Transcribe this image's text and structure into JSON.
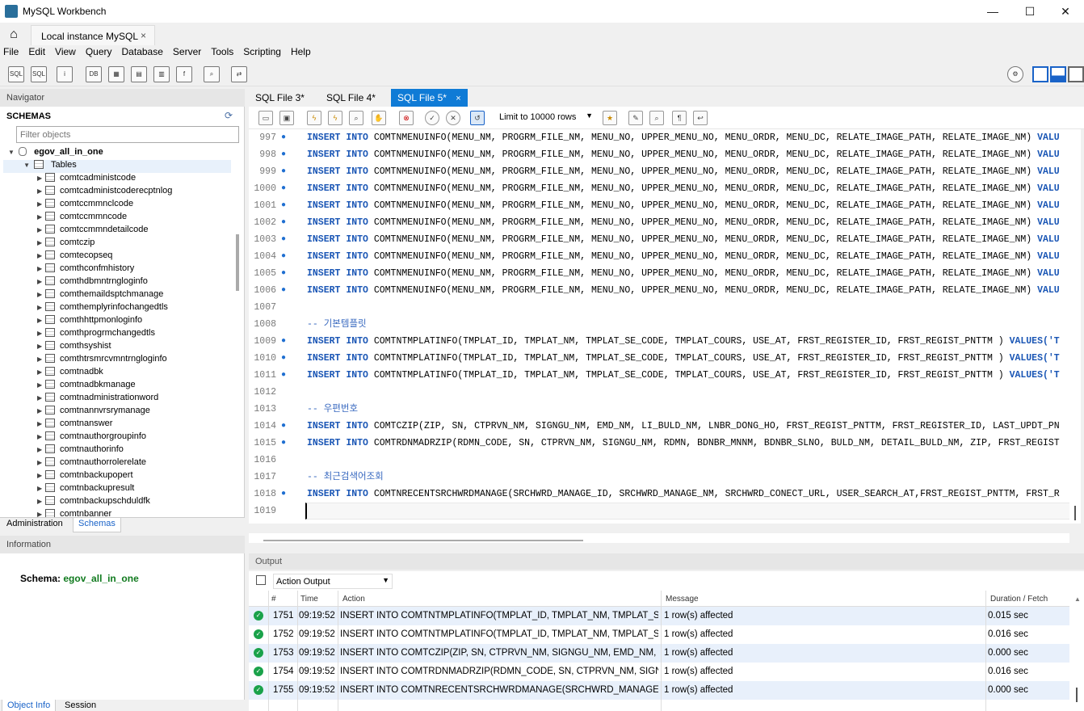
{
  "window": {
    "title": "MySQL Workbench",
    "minimize": "—",
    "maximize": "☐",
    "close": "✕"
  },
  "connection_tab": {
    "label": "Local instance MySQL",
    "close": "×",
    "home_icon": "⌂"
  },
  "menu": [
    "File",
    "Edit",
    "View",
    "Query",
    "Database",
    "Server",
    "Tools",
    "Scripting",
    "Help"
  ],
  "toolbar_icons": [
    "new-sql-tab-icon",
    "open-sql-script-icon",
    "inspector-icon",
    "create-schema-icon",
    "create-table-icon",
    "create-view-icon",
    "create-procedure-icon",
    "create-function-icon",
    "search-table-icon",
    "reconnect-icon"
  ],
  "navigator": {
    "header": "Navigator",
    "schemas_title": "SCHEMAS",
    "filter_placeholder": "Filter objects",
    "schema_name": "egov_all_in_one",
    "tables_label": "Tables",
    "tables": [
      "comtcadministcode",
      "comtcadministcoderecptnlog",
      "comtccmmnclcode",
      "comtccmmncode",
      "comtccmmndetailcode",
      "comtczip",
      "comtecopseq",
      "comthconfmhistory",
      "comthdbmntrngloginfo",
      "comthemaildsptchmanage",
      "comthemplyrinfochangedtls",
      "comthhttpmonloginfo",
      "comthprogrmchangedtls",
      "comthsyshist",
      "comthtrsmrcvmntrngloginfo",
      "comtnadbk",
      "comtnadbkmanage",
      "comtnadministrationword",
      "comtnannvrsrymanage",
      "comtnanswer",
      "comtnauthorgroupinfo",
      "comtnauthorinfo",
      "comtnauthorrolerelate",
      "comtnbackupopert",
      "comtnbackupresult",
      "comtnbackupschduldfk",
      "comtnbanner"
    ],
    "tabs": [
      "Administration",
      "Schemas"
    ]
  },
  "information": {
    "header": "Information",
    "schema_label": "Schema:",
    "schema_value": "egov_all_in_one",
    "tabs": [
      "Object Info",
      "Session"
    ]
  },
  "editor": {
    "tabs": [
      "SQL File 3*",
      "SQL File 4*",
      "SQL File 5*"
    ],
    "active_tab_close": "×",
    "limit_label": "Limit to 10000 rows",
    "lines": [
      {
        "n": "997",
        "dot": true,
        "kw1": "INSERT",
        "kw2": "INTO",
        "text": "COMTNMENUINFO(MENU_NM, PROGRM_FILE_NM, MENU_NO, UPPER_MENU_NO, MENU_ORDR, MENU_DC, RELATE_IMAGE_PATH, RELATE_IMAGE_NM)",
        "tail": "VALU"
      },
      {
        "n": "998",
        "dot": true,
        "kw1": "INSERT",
        "kw2": "INTO",
        "text": "COMTNMENUINFO(MENU_NM, PROGRM_FILE_NM, MENU_NO, UPPER_MENU_NO, MENU_ORDR, MENU_DC, RELATE_IMAGE_PATH, RELATE_IMAGE_NM)",
        "tail": "VALU"
      },
      {
        "n": "999",
        "dot": true,
        "kw1": "INSERT",
        "kw2": "INTO",
        "text": "COMTNMENUINFO(MENU_NM, PROGRM_FILE_NM, MENU_NO, UPPER_MENU_NO, MENU_ORDR, MENU_DC, RELATE_IMAGE_PATH, RELATE_IMAGE_NM)",
        "tail": "VALU"
      },
      {
        "n": "1000",
        "dot": true,
        "kw1": "INSERT",
        "kw2": "INTO",
        "text": "COMTNMENUINFO(MENU_NM, PROGRM_FILE_NM, MENU_NO, UPPER_MENU_NO, MENU_ORDR, MENU_DC, RELATE_IMAGE_PATH, RELATE_IMAGE_NM)",
        "tail": "VALU"
      },
      {
        "n": "1001",
        "dot": true,
        "kw1": "INSERT",
        "kw2": "INTO",
        "text": "COMTNMENUINFO(MENU_NM, PROGRM_FILE_NM, MENU_NO, UPPER_MENU_NO, MENU_ORDR, MENU_DC, RELATE_IMAGE_PATH, RELATE_IMAGE_NM)",
        "tail": "VALU"
      },
      {
        "n": "1002",
        "dot": true,
        "kw1": "INSERT",
        "kw2": "INTO",
        "text": "COMTNMENUINFO(MENU_NM, PROGRM_FILE_NM, MENU_NO, UPPER_MENU_NO, MENU_ORDR, MENU_DC, RELATE_IMAGE_PATH, RELATE_IMAGE_NM)",
        "tail": "VALU"
      },
      {
        "n": "1003",
        "dot": true,
        "kw1": "INSERT",
        "kw2": "INTO",
        "text": "COMTNMENUINFO(MENU_NM, PROGRM_FILE_NM, MENU_NO, UPPER_MENU_NO, MENU_ORDR, MENU_DC, RELATE_IMAGE_PATH, RELATE_IMAGE_NM)",
        "tail": "VALU"
      },
      {
        "n": "1004",
        "dot": true,
        "kw1": "INSERT",
        "kw2": "INTO",
        "text": "COMTNMENUINFO(MENU_NM, PROGRM_FILE_NM, MENU_NO, UPPER_MENU_NO, MENU_ORDR, MENU_DC, RELATE_IMAGE_PATH, RELATE_IMAGE_NM)",
        "tail": "VALU"
      },
      {
        "n": "1005",
        "dot": true,
        "kw1": "INSERT",
        "kw2": "INTO",
        "text": "COMTNMENUINFO(MENU_NM, PROGRM_FILE_NM, MENU_NO, UPPER_MENU_NO, MENU_ORDR, MENU_DC, RELATE_IMAGE_PATH, RELATE_IMAGE_NM)",
        "tail": "VALU"
      },
      {
        "n": "1006",
        "dot": true,
        "kw1": "INSERT",
        "kw2": "INTO",
        "text": "COMTNMENUINFO(MENU_NM, PROGRM_FILE_NM, MENU_NO, UPPER_MENU_NO, MENU_ORDR, MENU_DC, RELATE_IMAGE_PATH, RELATE_IMAGE_NM)",
        "tail": "VALU"
      },
      {
        "n": "1007",
        "dot": false,
        "kw1": "",
        "kw2": "",
        "text": "",
        "tail": ""
      },
      {
        "n": "1008",
        "dot": false,
        "kw1": "",
        "kw2": "",
        "comment": "-- 기본템플릿",
        "text": "",
        "tail": ""
      },
      {
        "n": "1009",
        "dot": true,
        "kw1": "INSERT",
        "kw2": "INTO",
        "text": "COMTNTMPLATINFO(TMPLAT_ID, TMPLAT_NM, TMPLAT_SE_CODE, TMPLAT_COURS, USE_AT, FRST_REGISTER_ID, FRST_REGIST_PNTTM )",
        "tail": "VALUES('T"
      },
      {
        "n": "1010",
        "dot": true,
        "kw1": "INSERT",
        "kw2": "INTO",
        "text": "COMTNTMPLATINFO(TMPLAT_ID, TMPLAT_NM, TMPLAT_SE_CODE, TMPLAT_COURS, USE_AT, FRST_REGISTER_ID, FRST_REGIST_PNTTM )",
        "tail": "VALUES('T"
      },
      {
        "n": "1011",
        "dot": true,
        "kw1": "INSERT",
        "kw2": "INTO",
        "text": "COMTNTMPLATINFO(TMPLAT_ID, TMPLAT_NM, TMPLAT_SE_CODE, TMPLAT_COURS, USE_AT, FRST_REGISTER_ID, FRST_REGIST_PNTTM )",
        "tail": "VALUES('T"
      },
      {
        "n": "1012",
        "dot": false,
        "kw1": "",
        "kw2": "",
        "text": "",
        "tail": ""
      },
      {
        "n": "1013",
        "dot": false,
        "kw1": "",
        "kw2": "",
        "comment": "-- 우편번호",
        "text": "",
        "tail": ""
      },
      {
        "n": "1014",
        "dot": true,
        "kw1": "INSERT",
        "kw2": "INTO",
        "text": "COMTCZIP(ZIP, SN, CTPRVN_NM, SIGNGU_NM, EMD_NM, LI_BULD_NM, LNBR_DONG_HO, FRST_REGIST_PNTTM, FRST_REGISTER_ID, LAST_UPDT_PN",
        "tail": ""
      },
      {
        "n": "1015",
        "dot": true,
        "kw1": "INSERT",
        "kw2": "INTO",
        "text": "COMTRDNMADRZIP(RDMN_CODE, SN, CTPRVN_NM, SIGNGU_NM, RDMN, BDNBR_MNNM, BDNBR_SLNO, BULD_NM, DETAIL_BULD_NM, ZIP, FRST_REGIST",
        "tail": ""
      },
      {
        "n": "1016",
        "dot": false,
        "kw1": "",
        "kw2": "",
        "text": "",
        "tail": ""
      },
      {
        "n": "1017",
        "dot": false,
        "kw1": "",
        "kw2": "",
        "comment": "-- 최근검색어조회",
        "text": "",
        "tail": ""
      },
      {
        "n": "1018",
        "dot": true,
        "kw1": "INSERT",
        "kw2": "INTO",
        "text": "COMTNRECENTSRCHWRDMANAGE(SRCHWRD_MANAGE_ID, SRCHWRD_MANAGE_NM, SRCHWRD_CONECT_URL, USER_SEARCH_AT,FRST_REGIST_PNTTM, FRST_R",
        "tail": ""
      },
      {
        "n": "1019",
        "dot": false,
        "kw1": "",
        "kw2": "",
        "text": "",
        "tail": "",
        "cursor": true
      }
    ]
  },
  "output": {
    "header": "Output",
    "action_select": "Action Output",
    "columns": [
      "#",
      "Time",
      "Action",
      "Message",
      "Duration / Fetch"
    ],
    "rows": [
      {
        "num": "1751",
        "time": "09:19:52",
        "action": "INSERT INTO COMTNTMPLATINFO(TMPLAT_ID, TMPLAT_NM, TMPLAT_SE...",
        "message": "1 row(s) affected",
        "duration": "0.015 sec"
      },
      {
        "num": "1752",
        "time": "09:19:52",
        "action": "INSERT INTO COMTNTMPLATINFO(TMPLAT_ID, TMPLAT_NM, TMPLAT_SE...",
        "message": "1 row(s) affected",
        "duration": "0.016 sec"
      },
      {
        "num": "1753",
        "time": "09:19:52",
        "action": "INSERT INTO COMTCZIP(ZIP, SN, CTPRVN_NM, SIGNGU_NM, EMD_NM, LI...",
        "message": "1 row(s) affected",
        "duration": "0.000 sec"
      },
      {
        "num": "1754",
        "time": "09:19:52",
        "action": "INSERT INTO COMTRDNMADRZIP(RDMN_CODE, SN, CTPRVN_NM, SIGNG...",
        "message": "1 row(s) affected",
        "duration": "0.016 sec"
      },
      {
        "num": "1755",
        "time": "09:19:52",
        "action": "INSERT INTO COMTNRECENTSRCHWRDMANAGE(SRCHWRD_MANAGE_I...",
        "message": "1 row(s) affected",
        "duration": "0.000 sec"
      }
    ]
  },
  "colors": {
    "active_tab": "#0f7bd6",
    "keyword": "#1a56b5",
    "schema_value": "#107a1e",
    "success": "#1aa24a"
  }
}
